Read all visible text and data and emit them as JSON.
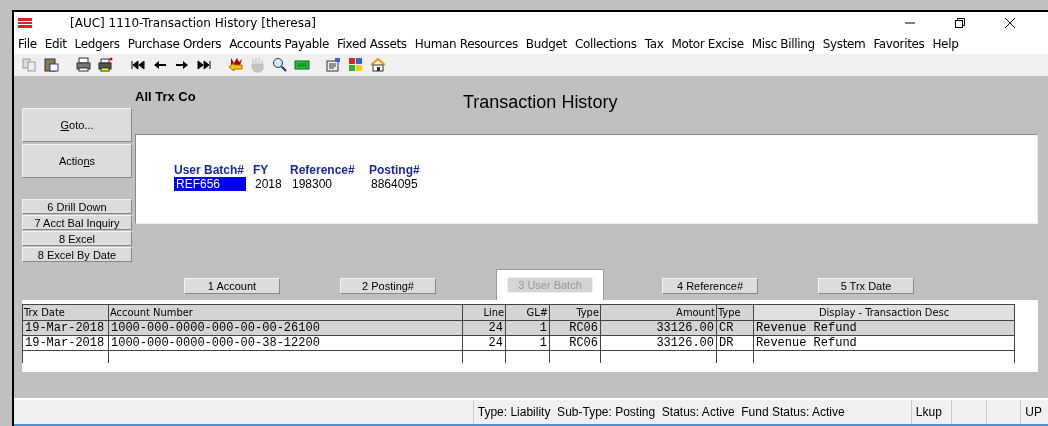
{
  "window": {
    "title": "[AUC] 1110-Transaction History [theresa]"
  },
  "menu": [
    "File",
    "Edit",
    "Ledgers",
    "Purchase Orders",
    "Accounts Payable",
    "Fixed Assets",
    "Human Resources",
    "Budget",
    "Collections",
    "Tax",
    "Motor Excise",
    "Misc Billing",
    "System",
    "Favorites",
    "Help"
  ],
  "toolbar": [
    {
      "kind": "copy",
      "disabled": false
    },
    {
      "kind": "paste",
      "disabled": false
    },
    {
      "kind": "sep"
    },
    {
      "kind": "print",
      "disabled": false
    },
    {
      "kind": "printer-setup",
      "disabled": false
    },
    {
      "kind": "sep"
    },
    {
      "kind": "first",
      "disabled": false
    },
    {
      "kind": "prev",
      "disabled": false
    },
    {
      "kind": "next",
      "disabled": false
    },
    {
      "kind": "last",
      "disabled": false
    },
    {
      "kind": "sep"
    },
    {
      "kind": "exit",
      "disabled": false
    },
    {
      "kind": "hand",
      "disabled": true
    },
    {
      "kind": "search",
      "disabled": false
    },
    {
      "kind": "screen",
      "disabled": false
    },
    {
      "kind": "sep"
    },
    {
      "kind": "properties",
      "disabled": false
    },
    {
      "kind": "colors",
      "disabled": false
    },
    {
      "kind": "home",
      "disabled": false
    }
  ],
  "company": "All Trx Co",
  "title": "Transaction History",
  "side_buttons": [
    {
      "access_key": "G",
      "text_after": "oto...",
      "kind": "large"
    },
    {
      "text_before": "Actio",
      "access_key": "n",
      "text_after": "s",
      "kind": "large"
    },
    {
      "label": "6 Drill Down",
      "kind": "small"
    },
    {
      "label": "7 Acct Bal Inquiry",
      "kind": "small"
    },
    {
      "label": "8 Excel",
      "kind": "small"
    },
    {
      "label": "8 Excel By Date",
      "kind": "small"
    }
  ],
  "fields": [
    {
      "label": "User Batch#",
      "value": "REF656",
      "selected": true
    },
    {
      "label": "FY",
      "value": "2018",
      "selected": false
    },
    {
      "label": "Reference#",
      "value": "198300",
      "selected": false
    },
    {
      "label": "Posting#",
      "value": "8864095",
      "selected": false
    }
  ],
  "sort_tabs": [
    {
      "label": "1 Account",
      "selected": false
    },
    {
      "label": "2 Posting#",
      "selected": false
    },
    {
      "label": "3 User Batch",
      "selected": true
    },
    {
      "label": "4 Reference#",
      "selected": false
    },
    {
      "label": "5 Trx Date",
      "selected": false
    }
  ],
  "table": {
    "columns": [
      "Trx Date",
      "Account Number",
      "Line",
      "GL#",
      "Type",
      "Amount",
      "Type",
      "Display - Transaction Desc"
    ],
    "rows": [
      {
        "cells": [
          "19-Mar-2018",
          "1000-000-0000-000-00-00-26100",
          "24",
          "1",
          "RC06",
          "33126.00",
          "CR",
          "Revenue Refund"
        ],
        "selected": true
      },
      {
        "cells": [
          "19-Mar-2018",
          "1000-000-0000-000-00-38-12200",
          "24",
          "1",
          "RC06",
          "33126.00",
          "DR",
          "Revenue Refund"
        ],
        "selected": false
      }
    ]
  },
  "status_bar": {
    "info": "Type: Liability  Sub-Type: Posting  Status: Active  Fund Status: Active",
    "lookup": "Lkup",
    "mode": "UP"
  }
}
